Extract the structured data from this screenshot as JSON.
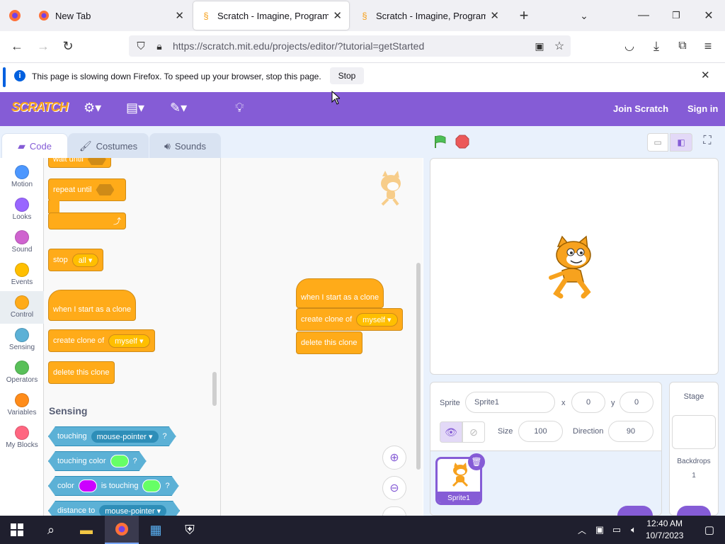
{
  "browser": {
    "tabs": [
      {
        "title": "New Tab"
      },
      {
        "title": "Scratch - Imagine, Program, Sh"
      },
      {
        "title": "Scratch - Imagine, Program, Sh"
      }
    ],
    "url": "https://scratch.mit.edu/projects/editor/?tutorial=getStarted",
    "infobar_text": "This page is slowing down Firefox. To speed up your browser, stop this page.",
    "stop_label": "Stop"
  },
  "scratch": {
    "logo": "SCRATCH",
    "join": "Join Scratch",
    "signin": "Sign in",
    "tabs": {
      "code": "Code",
      "costumes": "Costumes",
      "sounds": "Sounds"
    },
    "categories": [
      {
        "label": "Motion",
        "color": "#4c97ff"
      },
      {
        "label": "Looks",
        "color": "#9966ff"
      },
      {
        "label": "Sound",
        "color": "#cf63cf"
      },
      {
        "label": "Events",
        "color": "#ffbf00"
      },
      {
        "label": "Control",
        "color": "#ffab19"
      },
      {
        "label": "Sensing",
        "color": "#5cb1d6"
      },
      {
        "label": "Operators",
        "color": "#59c059"
      },
      {
        "label": "Variables",
        "color": "#ff8c1a"
      },
      {
        "label": "My Blocks",
        "color": "#ff6680"
      }
    ],
    "palette": {
      "wait_until": "wait until",
      "repeat_until": "repeat until",
      "stop": "stop",
      "stop_option": "all",
      "when_clone": "when I start as a clone",
      "create_clone": "create clone of",
      "create_clone_option": "myself",
      "delete_clone": "delete this clone",
      "sensing_heading": "Sensing",
      "touching": "touching",
      "touching_option": "mouse-pointer",
      "q": "?",
      "touching_color": "touching color",
      "color": "color",
      "is_touching": "is touching",
      "distance_to": "distance to",
      "distance_option": "mouse-pointer"
    },
    "script": {
      "when_clone": "when I start as a clone",
      "create_clone": "create clone of",
      "create_clone_option": "myself",
      "delete_clone": "delete this clone"
    },
    "sprite_info": {
      "sprite_label": "Sprite",
      "sprite_name": "Sprite1",
      "x_label": "x",
      "x": "0",
      "y_label": "y",
      "y": "0",
      "size_label": "Size",
      "size": "100",
      "direction_label": "Direction",
      "direction": "90",
      "thumb_name": "Sprite1"
    },
    "stage_pane": {
      "title": "Stage",
      "backdrops_label": "Backdrops",
      "backdrops_count": "1"
    }
  },
  "taskbar": {
    "time": "12:40 AM",
    "date": "10/7/2023"
  }
}
